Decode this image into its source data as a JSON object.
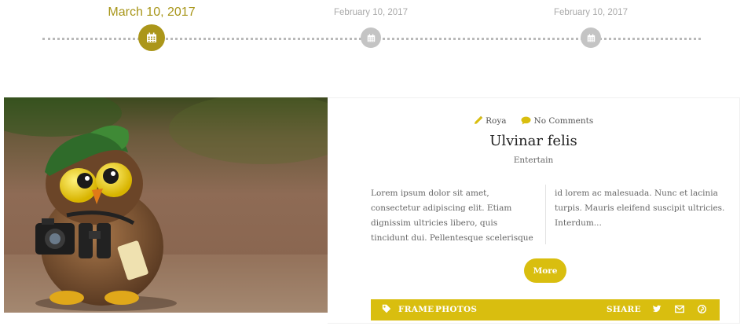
{
  "timeline": {
    "items": [
      {
        "date": "March 10, 2017",
        "state": "active",
        "icon": "calendar-icon"
      },
      {
        "date": "February 10, 2017",
        "state": "inactive",
        "icon": "calendar-icon"
      },
      {
        "date": "February 10, 2017",
        "state": "inactive",
        "icon": "calendar-icon"
      }
    ]
  },
  "post": {
    "author": "Roya",
    "author_icon": "pencil-icon",
    "comments": "No Comments",
    "comments_icon": "comment-icon",
    "title": "Ulvinar felis",
    "category": "Entertain",
    "excerpt_left": "Lorem ipsum dolor sit amet, consectetur adipiscing elit. Etiam dignissim ultricies libero, quis tincidunt dui. Pellentesque scelerisque",
    "excerpt_right": "id lorem ac malesuada. Nunc et lacinia turpis. Mauris eleifend suscipit ultricies. Interdum...",
    "more_label": "More",
    "tags_icon": "tag-icon",
    "tags": [
      "FRAME",
      "PHOTOS"
    ],
    "share_label": "SHARE",
    "share_icons": [
      "twitter-icon",
      "email-icon",
      "pinterest-icon"
    ]
  },
  "colors": {
    "accent": "#d9be0f",
    "timeline_active": "#ab961a",
    "timeline_inactive": "#c4c4c4"
  }
}
